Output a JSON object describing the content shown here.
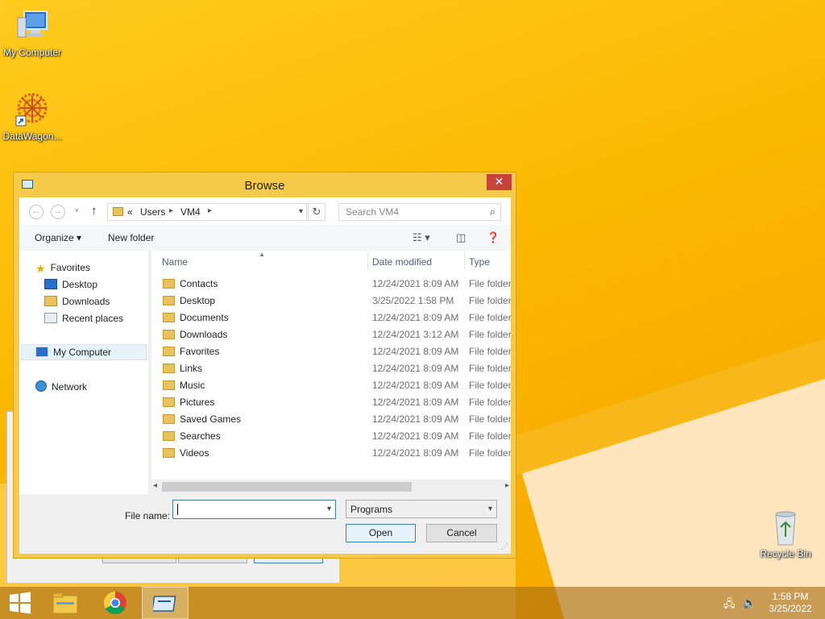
{
  "desktop": {
    "icons": [
      {
        "label": "My Computer"
      },
      {
        "label": "DataWagon..."
      },
      {
        "label": "Recycle Bin"
      }
    ]
  },
  "dialog": {
    "title": "Browse",
    "close_glyph": "✕",
    "nav": {
      "address_overflow": "«",
      "crumbs": [
        "Users",
        "VM4"
      ],
      "search_placeholder": "Search VM4"
    },
    "toolbar": {
      "organize_label": "Organize",
      "new_folder_label": "New folder"
    },
    "navpane": {
      "favorites": "Favorites",
      "favorites_items": [
        "Desktop",
        "Downloads",
        "Recent places"
      ],
      "my_computer": "My Computer",
      "network": "Network"
    },
    "columns": {
      "name": "Name",
      "date_modified": "Date modified",
      "type": "Type"
    },
    "files": [
      {
        "name": "Contacts",
        "date": "12/24/2021 8:09 AM",
        "type": "File folder"
      },
      {
        "name": "Desktop",
        "date": "3/25/2022 1:58 PM",
        "type": "File folder"
      },
      {
        "name": "Documents",
        "date": "12/24/2021 8:09 AM",
        "type": "File folder"
      },
      {
        "name": "Downloads",
        "date": "12/24/2021 3:12 AM",
        "type": "File folder"
      },
      {
        "name": "Favorites",
        "date": "12/24/2021 8:09 AM",
        "type": "File folder"
      },
      {
        "name": "Links",
        "date": "12/24/2021 8:09 AM",
        "type": "File folder"
      },
      {
        "name": "Music",
        "date": "12/24/2021 8:09 AM",
        "type": "File folder"
      },
      {
        "name": "Pictures",
        "date": "12/24/2021 8:09 AM",
        "type": "File folder"
      },
      {
        "name": "Saved Games",
        "date": "12/24/2021 8:09 AM",
        "type": "File folder"
      },
      {
        "name": "Searches",
        "date": "12/24/2021 8:09 AM",
        "type": "File folder"
      },
      {
        "name": "Videos",
        "date": "12/24/2021 8:09 AM",
        "type": "File folder"
      }
    ],
    "file_name_label": "File name:",
    "file_name_value": "",
    "filter_value": "Programs",
    "open_label": "Open",
    "cancel_label": "Cancel"
  },
  "taskbar": {
    "time": "1:58 PM",
    "date": "3/25/2022"
  },
  "colors": {
    "accent": "#3c7fb1",
    "close_red": "#c7433a",
    "frame": "#f5c94a"
  }
}
